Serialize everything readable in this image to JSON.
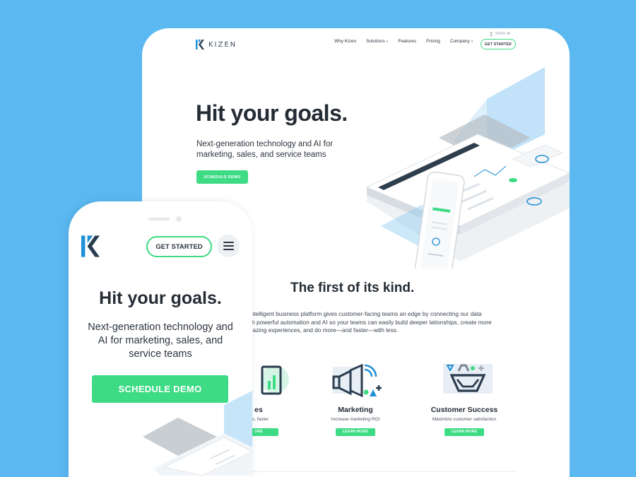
{
  "colors": {
    "background": "#5BB8F0",
    "accent_green": "#3ddb84",
    "text_dark": "#252c35",
    "logo_blue": "#1f8fd6"
  },
  "desktop": {
    "brand": "KIZEN",
    "sign_in": "SIGN IN",
    "nav": {
      "why_kizen": "Why Kizen",
      "solutions": "Solutions",
      "features": "Features",
      "pricing": "Pricing",
      "company": "Company"
    },
    "get_started": "GET STARTED",
    "hero_title": "Hit your goals.",
    "hero_subtitle": "Next-generation technology and AI for marketing, sales, and service teams",
    "schedule_demo": "SCHEDULE DEMO",
    "section_title": "The first of its kind.",
    "section_body": "n intelligent business platform gives customer-facing teams an edge by connecting our data with powerful automation and AI so your teams can easily build deeper lationships, create more amazing experiences, and do more—and faster—with less.",
    "features": [
      {
        "title": "es",
        "desc": "als, faster",
        "button": "ORE"
      },
      {
        "title": "Marketing",
        "desc": "Increase marketing ROI",
        "button": "LEARN MORE"
      },
      {
        "title": "Customer Success",
        "desc": "Maximize customer satisfaction",
        "button": "LEARN MORE"
      }
    ]
  },
  "mobile": {
    "get_started": "GET STARTED",
    "hero_title": "Hit your goals.",
    "hero_subtitle": "Next-generation technology and AI for marketing, sales, and service teams",
    "schedule_demo": "SCHEDULE DEMO"
  }
}
